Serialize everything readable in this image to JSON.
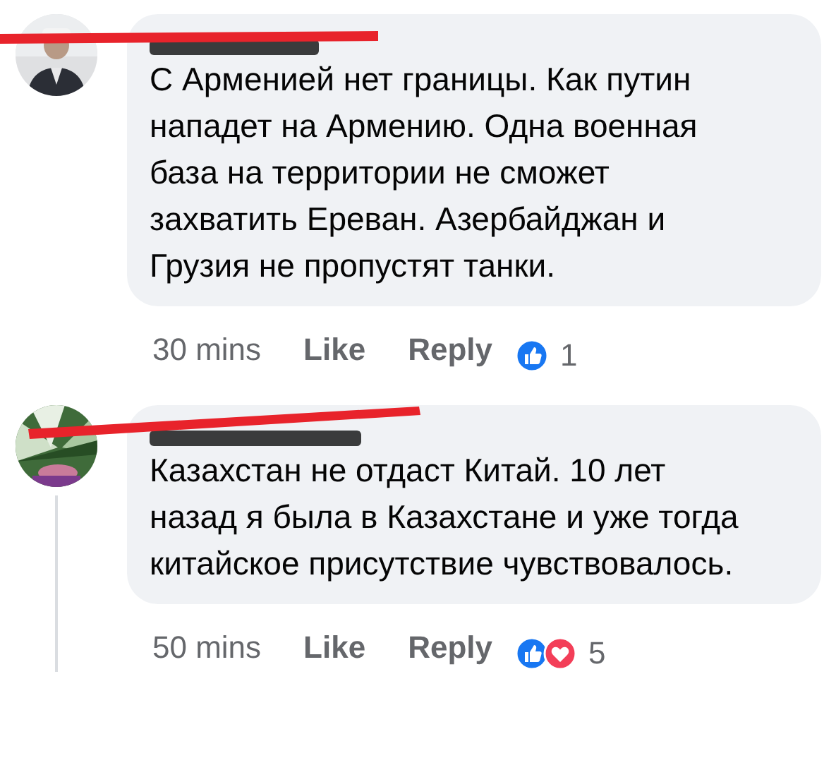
{
  "comments": [
    {
      "text": "С Арменией нет границы. Как путин нападет на Армению. Одна военная база на территории не сможет захватить Ереван. Азербайджан и Грузия не пропустят танки.",
      "time": "30 mins",
      "like": "Like",
      "reply": "Reply",
      "reactions": [
        {
          "kind": "like"
        }
      ],
      "reaction_count": "1",
      "avatar": {
        "kind": "picture"
      }
    },
    {
      "text": "Казахстан не отдаст Китай. 10 лет назад я была в Казахстане и уже тогда китайское присутствие чувствовалось.",
      "time": "50 mins",
      "like": "Like",
      "reply": "Reply",
      "reactions": [
        {
          "kind": "like"
        },
        {
          "kind": "love"
        }
      ],
      "reaction_count": "5",
      "avatar": {
        "kind": "picture"
      }
    }
  ]
}
